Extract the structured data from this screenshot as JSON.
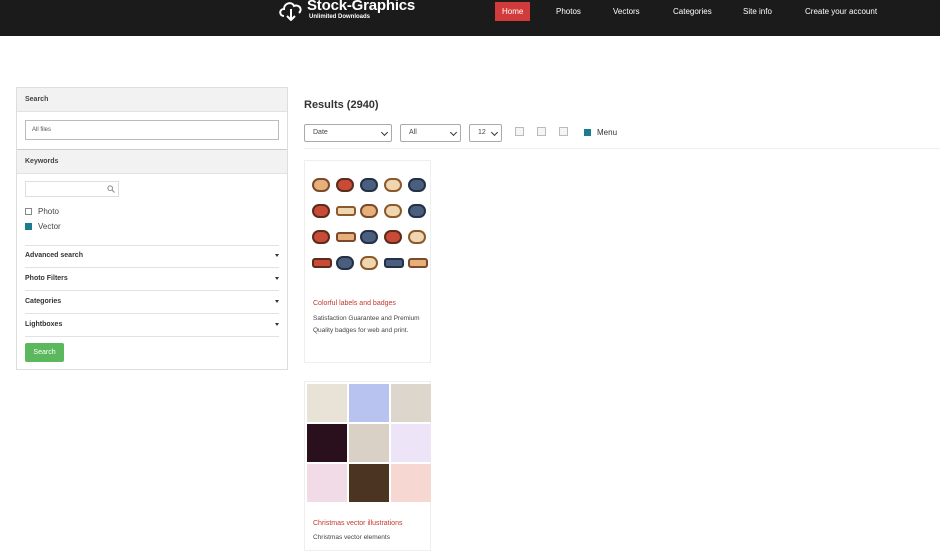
{
  "header": {
    "logo_title": "Stock-Graphics",
    "logo_subtitle": "Unlimited Downloads",
    "nav": [
      {
        "label": "Home",
        "active": true
      },
      {
        "label": "Photos",
        "active": false
      },
      {
        "label": "Vectors",
        "active": false
      },
      {
        "label": "Categories",
        "active": false
      },
      {
        "label": "Site info",
        "active": false
      },
      {
        "label": "Create your account",
        "active": false
      }
    ],
    "colors": {
      "bar": "#1b1b1b",
      "active": "#d23b3b"
    }
  },
  "sidebar": {
    "search_heading": "Search",
    "search_value": "All files",
    "keywords_heading": "Keywords",
    "keyword_value": "",
    "checkboxes": [
      {
        "label": "Photo",
        "checked": false
      },
      {
        "label": "Vector",
        "checked": true
      }
    ],
    "sections": [
      {
        "label": "Advanced search"
      },
      {
        "label": "Photo Filters"
      },
      {
        "label": "Categories"
      },
      {
        "label": "Lightboxes"
      }
    ],
    "search_button": "Search",
    "button_color": "#5cb85c"
  },
  "results": {
    "title": "Results (2940)",
    "sort_select": "Date",
    "type_select": "All",
    "per_page_select": "12",
    "menu_checked": true,
    "menu_label": "Menu",
    "cards": [
      {
        "title": "Colorful labels and badges",
        "description": "Satisfaction Guarantee and Premium Quality badges for web and print."
      },
      {
        "title": "Christmas vector illustrations",
        "description": "Christmas vector elements"
      }
    ],
    "title_color": "#c0392b"
  }
}
